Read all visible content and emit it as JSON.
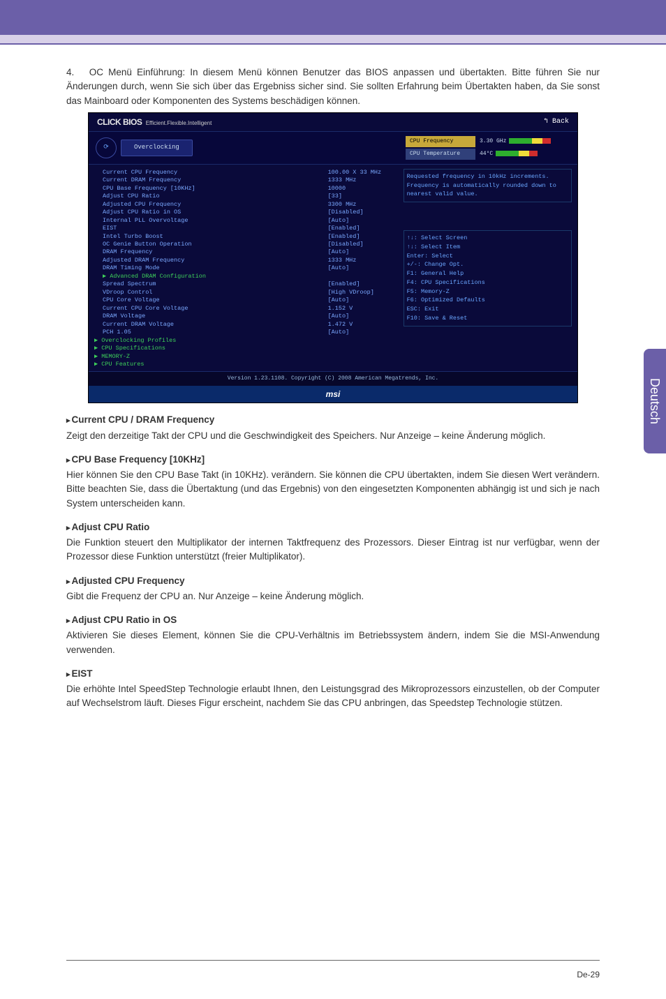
{
  "intro_num": "4.",
  "intro_text": "OC Menü Einführung: In diesem Menü können Benutzer das BIOS anpassen und übertakten. Bitte führen Sie nur Änderungen durch, wenn Sie sich über das Ergebniss sicher sind.  Sie sollten Erfahrung beim Übertakten haben, da Sie sonst das Mainboard oder Komponenten des Systems beschädigen können.",
  "bios": {
    "logo_main": "CLICK BIOS",
    "logo_sub": "Efficient.Flexible.Intelligent",
    "back": "↰ Back",
    "tab": "Overclocking",
    "readouts": {
      "r1_label": "CPU Frequency",
      "r1_val": "3.30 GHz",
      "r2_label": "CPU Temperature",
      "r2_val": "44°C"
    },
    "settings": [
      {
        "label": "Current CPU Frequency",
        "val": "100.00 X 33 MHz"
      },
      {
        "label": "Current DRAM Frequency",
        "val": "1333 MHz"
      },
      {
        "label": "CPU Base Frequency [10KHz]",
        "val": "10000"
      },
      {
        "label": "Adjust CPU Ratio",
        "val": "[33]"
      },
      {
        "label": "Adjusted CPU Frequency",
        "val": "3300 MHz"
      },
      {
        "label": "Adjust CPU Ratio in OS",
        "val": "[Disabled]"
      },
      {
        "label": "Internal PLL Overvoltage",
        "val": "[Auto]"
      },
      {
        "label": "EIST",
        "val": "[Enabled]"
      },
      {
        "label": "Intel Turbo Boost",
        "val": "[Enabled]"
      },
      {
        "label": "OC Genie Button Operation",
        "val": "[Disabled]"
      },
      {
        "label": "DRAM Frequency",
        "val": "[Auto]"
      },
      {
        "label": "Adjusted DRAM Frequency",
        "val": "1333 MHz"
      },
      {
        "label": "DRAM Timing Mode",
        "val": "[Auto]"
      }
    ],
    "adv_dram": "Advanced DRAM Configuration",
    "settings2": [
      {
        "label": "Spread Spectrum",
        "val": "[Enabled]"
      },
      {
        "label": "VDroop Control",
        "val": "[High VDroop]"
      },
      {
        "label": "CPU Core Voltage",
        "val": "[Auto]"
      },
      {
        "label": "Current CPU Core Voltage",
        "val": "1.152 V"
      },
      {
        "label": "DRAM Voltage",
        "val": "[Auto]"
      },
      {
        "label": "Current DRAM Voltage",
        "val": "1.472 V"
      },
      {
        "label": "PCH 1.05",
        "val": "[Auto]"
      }
    ],
    "menus": [
      "Overclocking Profiles",
      "CPU Specifications",
      "MEMORY-Z",
      "CPU Features"
    ],
    "help1": "Requested frequency in 10kHz increments. Frequency is automatically rounded down to nearest valid value.",
    "keys": [
      "↑↓: Select Screen",
      "↑↓: Select Item",
      "Enter: Select",
      "+/-: Change Opt.",
      "F1: General Help",
      "F4: CPU Specifications",
      "F5: Memory-Z",
      "F6: Optimized Defaults",
      "ESC: Exit",
      "F10: Save & Reset"
    ],
    "version": "Version 1.23.1108. Copyright (C) 2008 American Megatrends, Inc.",
    "brand": "msi"
  },
  "items": [
    {
      "h": "Current CPU / DRAM Frequency",
      "b": "Zeigt den derzeitige Takt der CPU und die Geschwindigkeit des Speichers. Nur Anzeige – keine Änderung möglich."
    },
    {
      "h": "CPU Base Frequency [10KHz]",
      "b": "Hier können Sie den CPU Base Takt (in 10KHz). verändern. Sie können die CPU übertakten, indem Sie diesen Wert verändern. Bitte beachten Sie, dass die Übertaktung (und das Ergebnis) von den eingesetzten Komponenten abhängig ist und sich je nach System unterscheiden kann."
    },
    {
      "h": "Adjust CPU Ratio",
      "b": "Die Funktion steuert den Multiplikator der internen Taktfrequenz des Prozessors. Dieser Eintrag ist nur verfügbar, wenn der Prozessor diese Funktion unterstützt (freier Multiplikator)."
    },
    {
      "h": "Adjusted CPU Frequency",
      "b": "Gibt die Frequenz der CPU an. Nur Anzeige – keine Änderung möglich."
    },
    {
      "h": "Adjust CPU Ratio in OS",
      "b": "Aktivieren Sie dieses Element, können Sie die CPU-Verhältnis im Betriebssystem ändern, indem Sie die MSI-Anwendung verwenden."
    },
    {
      "h": "EIST",
      "b": "Die erhöhte Intel SpeedStep Technologie erlaubt Ihnen, den Leistungsgrad des Mikroprozessors einzustellen, ob der Computer auf Wechselstrom läuft. Dieses Figur erscheint, nachdem Sie das CPU anbringen, das Speedstep Technologie stützen."
    }
  ],
  "side_tab": "Deutsch",
  "page_num": "De-29"
}
